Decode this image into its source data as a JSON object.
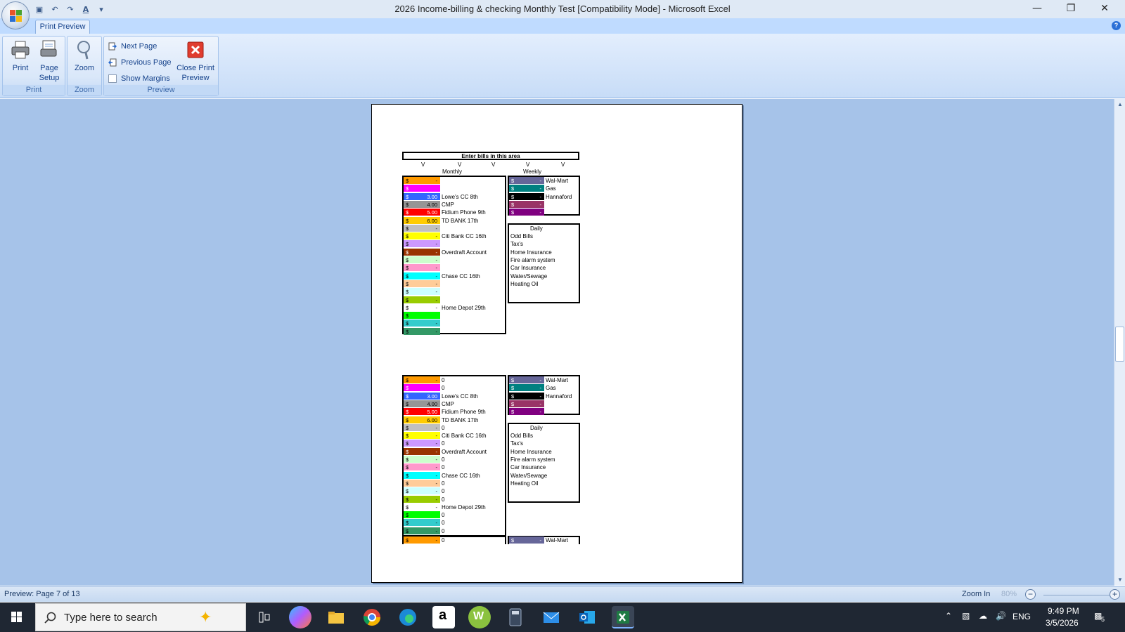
{
  "window": {
    "title": "2026 Income-billing & checking Monthly Test  [Compatibility Mode] - Microsoft Excel",
    "minimize": "—",
    "restore": "❐",
    "close": "✕"
  },
  "ribbon": {
    "tab": "Print Preview",
    "groups": {
      "print": {
        "label": "Print",
        "print_btn": "Print",
        "page_setup_line1": "Page",
        "page_setup_line2": "Setup"
      },
      "zoom": {
        "label": "Zoom",
        "zoom_btn": "Zoom"
      },
      "preview": {
        "label": "Preview",
        "next_page": "Next Page",
        "previous_page": "Previous Page",
        "show_margins": "Show Margins",
        "close_line1": "Close Print",
        "close_line2": "Preview"
      }
    }
  },
  "sheet": {
    "header": "Enter bills in this area",
    "v_mark": "V",
    "monthly_label": "Monthly",
    "weekly_label": "Weekly",
    "daily_label": "Daily",
    "currency": "$",
    "monthly_rows": [
      {
        "color": "#ff9a00",
        "value": "-",
        "label": "",
        "label2": "0"
      },
      {
        "color": "#ff00ff",
        "value": "",
        "label": "",
        "label2": "0"
      },
      {
        "color": "#3366ff",
        "value": "3.00",
        "label": "Lowe's CC 8th",
        "label2": "Lowe's CC 8th"
      },
      {
        "color": "#969696",
        "value": "4.00",
        "label": "CMP",
        "label2": "CMP"
      },
      {
        "color": "#ff0000",
        "value": "5.00",
        "label": "Fidium Phone 9th",
        "label2": "Fidium Phone 9th"
      },
      {
        "color": "#ffcc00",
        "value": "6.00",
        "label": "TD BANK 17th",
        "label2": "TD BANK 17th"
      },
      {
        "color": "#c0c0c0",
        "value": "-",
        "label": "",
        "label2": "0"
      },
      {
        "color": "#ffff00",
        "value": "-",
        "label": "Citi Bank CC 16th",
        "label2": "Citi Bank CC 16th"
      },
      {
        "color": "#cc99ff",
        "value": "-",
        "label": "",
        "label2": "0"
      },
      {
        "color": "#993300",
        "value": "-",
        "label": "Overdraft Account",
        "label2": "Overdraft Account"
      },
      {
        "color": "#ccffcc",
        "value": "-",
        "label": "",
        "label2": "0"
      },
      {
        "color": "#ff99cc",
        "value": "-",
        "label": "",
        "label2": "0"
      },
      {
        "color": "#00ffff",
        "value": "-",
        "label": "Chase CC 16th",
        "label2": "Chase CC 16th"
      },
      {
        "color": "#ffcc99",
        "value": "-",
        "label": "",
        "label2": "0"
      },
      {
        "color": "#ccffff",
        "value": "-",
        "label": "",
        "label2": "0"
      },
      {
        "color": "#99cc00",
        "value": "-",
        "label": "",
        "label2": "0"
      },
      {
        "color": "#ffffff",
        "value": "-",
        "label": "Home Depot 29th",
        "label2": "Home Depot 29th"
      },
      {
        "color": "#00ff00",
        "value": "",
        "label": "",
        "label2": "0"
      },
      {
        "color": "#33cccc",
        "value": "-",
        "label": "",
        "label2": "0"
      },
      {
        "color": "#339966",
        "value": "-",
        "label": "",
        "label2": "0"
      }
    ],
    "weekly_rows": [
      {
        "color": "#666699",
        "value": "-",
        "label": "Wal-Mart"
      },
      {
        "color": "#008080",
        "value": "-",
        "label": "Gas"
      },
      {
        "color": "#000000",
        "value": "-",
        "label": "Hannaford"
      },
      {
        "color": "#993366",
        "value": "-",
        "label": ""
      },
      {
        "color": "#800080",
        "value": "-",
        "label": ""
      }
    ],
    "daily_items": [
      "Odd Bills",
      "Tax's",
      "Home Insurance",
      "Fire alarm system",
      "Car Insurance",
      "Water/Sewage",
      "Heating Oil"
    ],
    "bottom_row": {
      "monthly_value": "-",
      "monthly_label": "0",
      "weekly_value": "-",
      "weekly_label": "Wal-Mart"
    }
  },
  "status": {
    "preview": "Preview: Page 7 of 13",
    "zoom_in": "Zoom In",
    "zoom_pct": "80%",
    "minus": "−",
    "plus": "+"
  },
  "taskbar": {
    "search_placeholder": "Type here to search",
    "lang": "ENG",
    "time": "9:49 PM",
    "date": "3/5/2026",
    "notif_count": "5"
  }
}
